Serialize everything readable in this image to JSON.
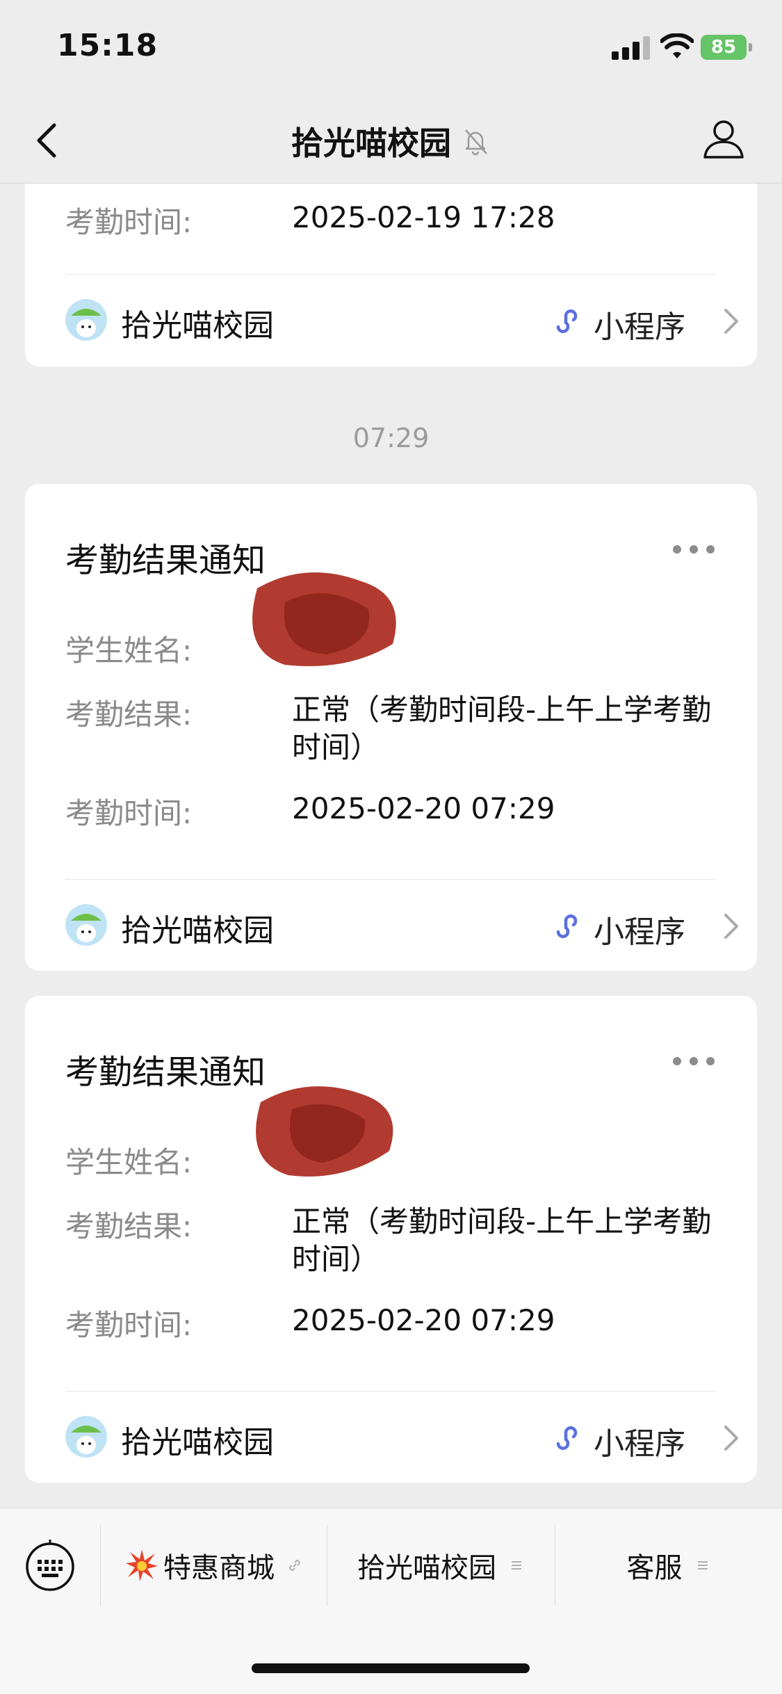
{
  "status_bar": {
    "time": "15:18",
    "battery": "85"
  },
  "nav": {
    "title": "拾光喵校园"
  },
  "cards": [
    {
      "fields": [
        {
          "label": "考勤时间:",
          "value": "2025-02-19 17:28"
        }
      ],
      "footer": {
        "app_name": "拾光喵校园",
        "mini_label": "小程序"
      }
    },
    {
      "title": "考勤结果通知",
      "fields": [
        {
          "label": "学生姓名:",
          "value": ""
        },
        {
          "label": "考勤结果:",
          "value": "正常（考勤时间段-上午上学考勤时间）"
        },
        {
          "label": "考勤时间:",
          "value": "2025-02-20 07:29"
        }
      ],
      "footer": {
        "app_name": "拾光喵校园",
        "mini_label": "小程序"
      }
    },
    {
      "title": "考勤结果通知",
      "fields": [
        {
          "label": "学生姓名:",
          "value": ""
        },
        {
          "label": "考勤结果:",
          "value": "正常（考勤时间段-上午上学考勤时间）"
        },
        {
          "label": "考勤时间:",
          "value": "2025-02-20 07:29"
        }
      ],
      "footer": {
        "app_name": "拾光喵校园",
        "mini_label": "小程序"
      }
    }
  ],
  "timestamp": "07:29",
  "bottom_menu": {
    "items": [
      {
        "label": "特惠商城"
      },
      {
        "label": "拾光喵校园"
      },
      {
        "label": "客服"
      }
    ]
  },
  "colors": {
    "accent_link": "#5b6ee1",
    "battery": "#64c466",
    "redaction": "#a8261a"
  }
}
